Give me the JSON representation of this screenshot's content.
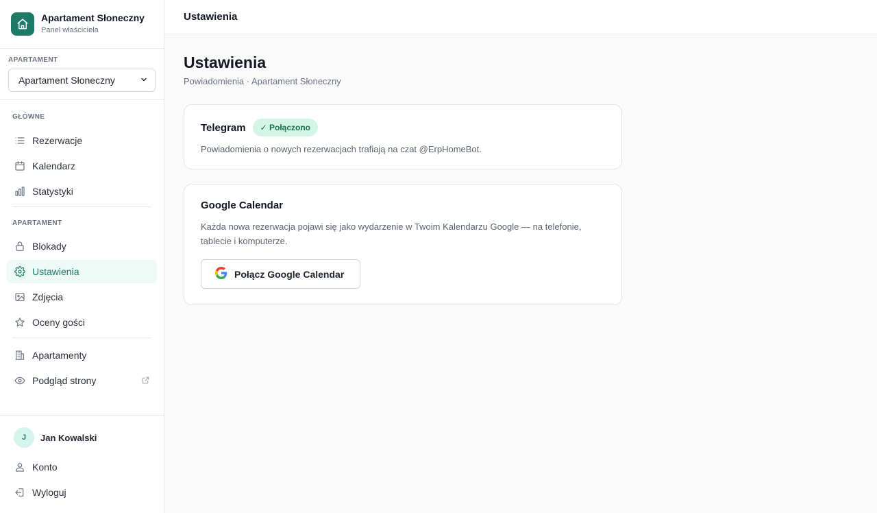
{
  "brand": {
    "title": "Apartament Słoneczny",
    "subtitle": "Panel właściciela"
  },
  "apartment_selector": {
    "label": "APARTAMENT",
    "selected": "Apartament Słoneczny"
  },
  "nav": {
    "main_label": "GŁÓWNE",
    "main_items": [
      {
        "label": "Rezerwacje",
        "icon": "list-icon"
      },
      {
        "label": "Kalendarz",
        "icon": "calendar-icon"
      },
      {
        "label": "Statystyki",
        "icon": "bar-chart-icon"
      }
    ],
    "apartment_label": "APARTAMENT",
    "apartment_items": [
      {
        "label": "Blokady",
        "icon": "lock-icon"
      },
      {
        "label": "Ustawienia",
        "icon": "gear-icon",
        "active": true
      },
      {
        "label": "Zdjęcia",
        "icon": "image-icon"
      },
      {
        "label": "Oceny gości",
        "icon": "star-icon"
      }
    ],
    "extra_items": [
      {
        "label": "Apartamenty",
        "icon": "building-icon"
      },
      {
        "label": "Podgląd strony",
        "icon": "eye-icon",
        "external": true
      }
    ]
  },
  "user": {
    "initial": "J",
    "name": "Jan Kowalski",
    "account_label": "Konto",
    "logout_label": "Wyloguj"
  },
  "header": {
    "title": "Ustawienia"
  },
  "page": {
    "title": "Ustawienia",
    "subtitle": "Powiadomienia · Apartament Słoneczny"
  },
  "telegram": {
    "title": "Telegram",
    "badge": "✓ Połączono",
    "description": "Powiadomienia o nowych rezerwacjach trafiają na czat @ErpHomeBot."
  },
  "google": {
    "title": "Google Calendar",
    "description": "Każda nowa rezerwacja pojawi się jako wydarzenie w Twoim Kalendarzu Google — na telefonie, tablecie i komputerze.",
    "button_label": "Połącz Google Calendar"
  },
  "colors": {
    "accent": "#1c7a67",
    "badge_bg": "#d4f5e6",
    "badge_text": "#17724f",
    "active_bg": "#eefaf6"
  }
}
